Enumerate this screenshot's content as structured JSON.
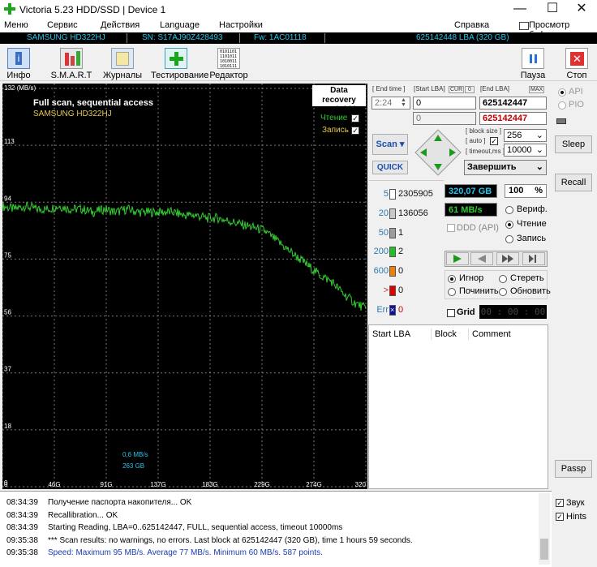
{
  "window": {
    "title": "Victoria 5.23 HDD/SSD | Device 1",
    "minimize": "—",
    "maximize": "☐",
    "close": "✕"
  },
  "menu": [
    "Меню",
    "Сервис",
    "Действия",
    "Language",
    "Настройки",
    "Справка"
  ],
  "clipboard": "Просмотр буфера",
  "info": {
    "model": "SAMSUNG HD322HJ",
    "sn": "SN: S17AJ90Z428493",
    "fw": "Fw: 1AC01118",
    "lba": "625142448 LBA (320 GB)"
  },
  "toolbar": {
    "info": "Инфо",
    "smart": "S.M.A.R.T",
    "journals": "Журналы",
    "testing": "Тестирование",
    "editor": "Редактор",
    "pause": "Пауза",
    "stop": "Стоп",
    "editor_icon_text": "0101101\n1101011\n1010011\n1010111"
  },
  "graph": {
    "title": "Full scan, sequential access",
    "subtitle": "SAMSUNG HD322HJ",
    "unit": "132 (MB/s)",
    "brand1": "Data recovery",
    "brand2": "www.hdd.by",
    "read": "Чтение",
    "write": "Запись",
    "cur_speed": "0,6 MB/s",
    "cur_pos": "263 GB"
  },
  "chart_data": {
    "type": "line",
    "title": "Full scan, sequential access",
    "ylabel": "MB/s",
    "ylim": [
      0,
      132
    ],
    "xlim": [
      0,
      320
    ],
    "y_ticks": [
      "113",
      "94",
      "75",
      "56",
      "37",
      "18",
      "0"
    ],
    "x_ticks": [
      "0",
      "46G",
      "91G",
      "137G",
      "183G",
      "229G",
      "274G",
      "320"
    ],
    "series": [
      {
        "name": "Чтение",
        "color": "#33cc33",
        "x": [
          0,
          10,
          20,
          30,
          40,
          50,
          60,
          70,
          80,
          90,
          100,
          110,
          120,
          130,
          140,
          150,
          160,
          170,
          180,
          190,
          200,
          210,
          220,
          230,
          240,
          250,
          260,
          270,
          280,
          290,
          300,
          310,
          320
        ],
        "y": [
          93,
          92,
          93,
          92,
          92,
          93,
          92,
          92,
          91,
          92,
          91,
          92,
          91,
          91,
          91,
          91,
          90,
          90,
          89,
          89,
          88,
          87,
          86,
          85,
          82,
          79,
          76,
          73,
          70,
          68,
          64,
          61,
          59
        ]
      }
    ]
  },
  "controls": {
    "end_time_label": "[ End time ]",
    "end_time": "2:24",
    "start_lba_label": "[Start LBA]",
    "cur": "CUR",
    "cur_val": "0",
    "end_lba_label": "[End LBA]",
    "max": "MAX",
    "start_lba": "0",
    "start_lba2": "0",
    "end_lba": "625142447",
    "end_lba2": "625142447",
    "scan": "Scan",
    "quick": "QUICK",
    "block_size_label": "[ block size ]",
    "auto_label": "[ auto ]",
    "timeout_label": "[ timeout,ms ]",
    "block_size": "256",
    "timeout": "10000",
    "finish": "Завершить"
  },
  "blocks": [
    {
      "ms": "5",
      "count": "2305905",
      "color": "#ffffff"
    },
    {
      "ms": "20",
      "count": "136056",
      "color": "#c8c8c8"
    },
    {
      "ms": "50",
      "count": "1",
      "color": "#9c9c9c"
    },
    {
      "ms": "200",
      "count": "2",
      "color": "#22c022"
    },
    {
      "ms": "600",
      "count": "0",
      "color": "#f08000"
    },
    {
      "ms": ">",
      "count": "0",
      "color": "#e00000"
    },
    {
      "ms": "Err",
      "count": "0",
      "color": "#1010a0"
    }
  ],
  "stats": {
    "size": "320,07 GB",
    "percent": "100",
    "pct_sign": "%",
    "speed": "61 MB/s",
    "ddd": "DDD (API)"
  },
  "modes": {
    "verify": "Вериф.",
    "read": "Чтение",
    "write": "Запись"
  },
  "actions": {
    "ignore": "Игнор",
    "erase": "Стереть",
    "repair": "Починить",
    "refresh": "Обновить"
  },
  "grid": {
    "label": "Grid",
    "timer": "00 : 00 : 00"
  },
  "table": {
    "col1": "Start LBA",
    "col2": "Block",
    "col3": "Comment"
  },
  "right": {
    "api": "API",
    "pio": "PIO",
    "sleep": "Sleep",
    "recall": "Recall",
    "passp": "Passp",
    "sound": "Звук",
    "hints": "Hints"
  },
  "log": [
    {
      "t": "08:34:39",
      "m": "Получение паспорта накопителя... OK",
      "c": "#000000"
    },
    {
      "t": "08:34:39",
      "m": "Recallibration... OK",
      "c": "#000000"
    },
    {
      "t": "08:34:39",
      "m": "Starting Reading, LBA=0..625142447, FULL, sequential access, timeout 10000ms",
      "c": "#000000"
    },
    {
      "t": "09:35:38",
      "m": "*** Scan results: no warnings, no errors. Last block at 625142447 (320 GB), time 1 hours 59 seconds.",
      "c": "#000000"
    },
    {
      "t": "09:35:38",
      "m": "Speed: Maximum 95 MB/s. Average 77 MB/s. Minimum 60 MB/s. 587 points.",
      "c": "#1a3cb0"
    }
  ]
}
